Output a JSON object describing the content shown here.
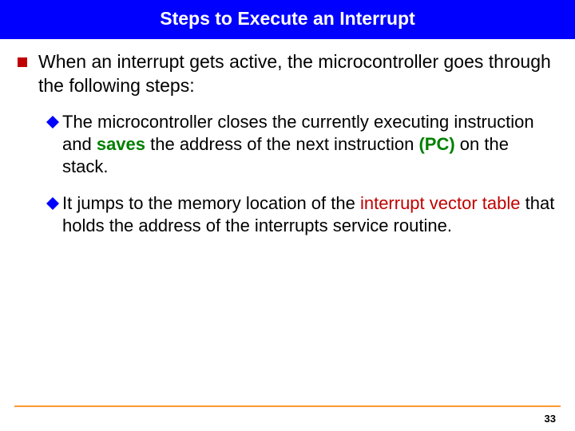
{
  "title": "Steps to Execute an Interrupt",
  "intro": "When an interrupt gets active, the microcontroller goes through the following steps:",
  "bullets": [
    {
      "pre": "The microcontroller closes the currently executing instruction and ",
      "kw1": "saves",
      "mid": " the address of the next instruction ",
      "kw2": "(PC)",
      "post": " on the stack."
    },
    {
      "pre": "It jumps to the memory location of the ",
      "kw1": "interrupt vector table",
      "post": " that holds the address of the interrupts service routine."
    }
  ],
  "pageNumber": "33"
}
